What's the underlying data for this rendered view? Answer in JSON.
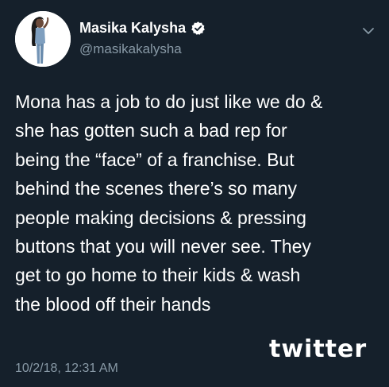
{
  "user": {
    "display_name": "Masika Kalysha",
    "handle": "@masikakalysha",
    "verified": true
  },
  "icons": {
    "verified": "verified-badge-icon",
    "menu": "chevron-down-icon"
  },
  "tweet": {
    "lines": [
      "Mona has a job to do just like we do &",
      "she has gotten such a bad rep for",
      "being the “face” of a franchise. But",
      "behind the scenes there’s so many",
      "people making decisions & pressing",
      "buttons that you will never see. They",
      "get to go home to their kids & wash",
      "the blood off their hands"
    ],
    "timestamp": "10/2/18, 12:31 AM"
  },
  "watermark": "twitter",
  "colors": {
    "background": "#15202b",
    "text": "#ffffff",
    "secondary_text": "#8899a6"
  }
}
